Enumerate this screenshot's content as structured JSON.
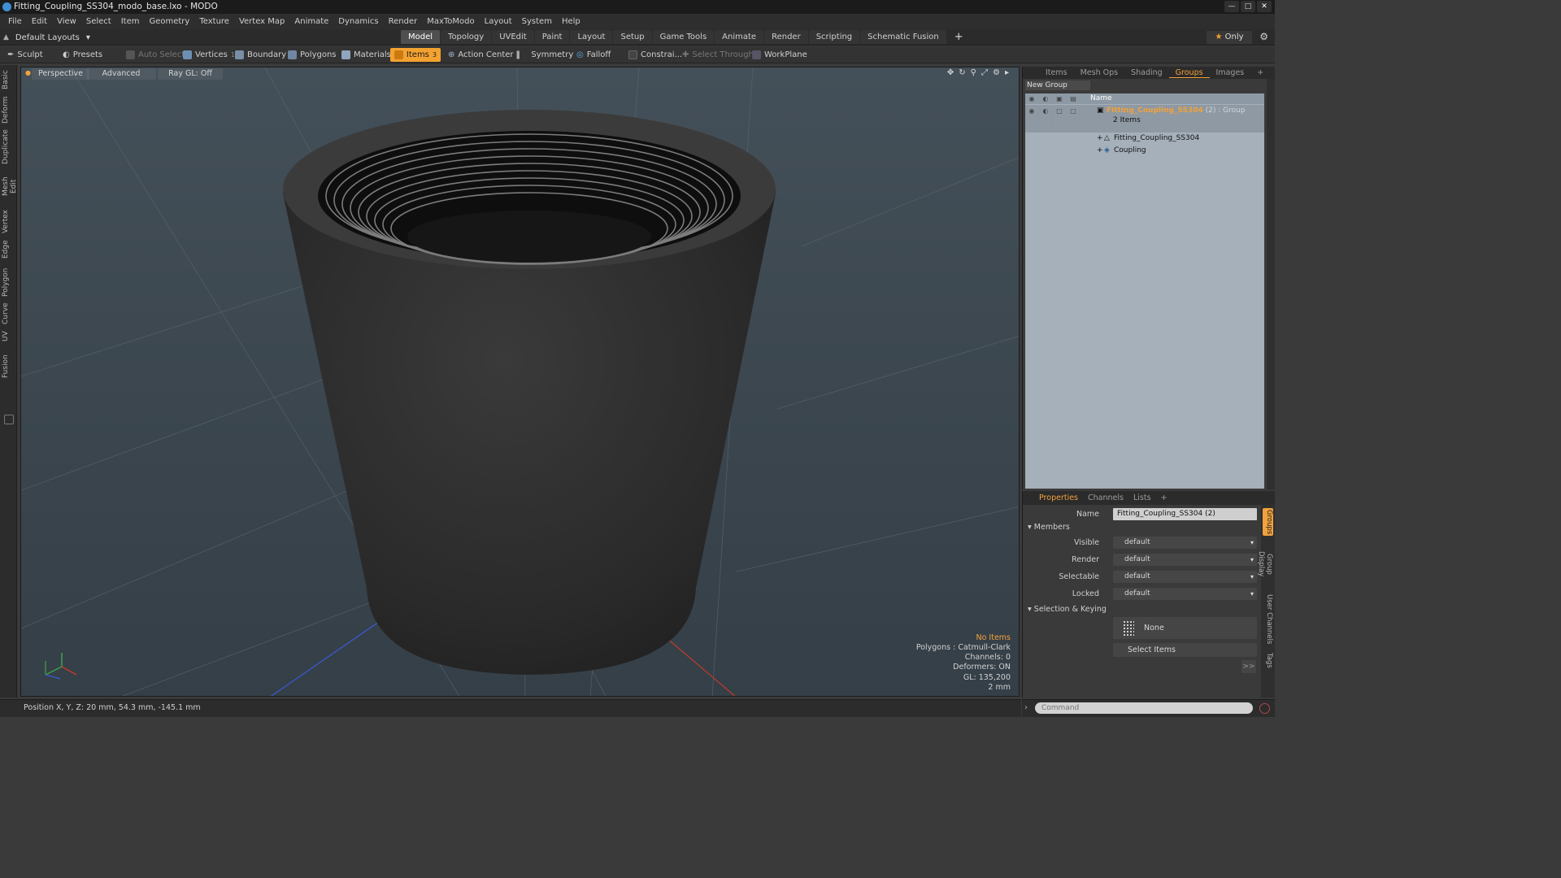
{
  "window": {
    "title": "Fitting_Coupling_SS304_modo_base.lxo - MODO"
  },
  "menu": [
    "File",
    "Edit",
    "View",
    "Select",
    "Item",
    "Geometry",
    "Texture",
    "Vertex Map",
    "Animate",
    "Dynamics",
    "Render",
    "MaxToModo",
    "Layout",
    "System",
    "Help"
  ],
  "layouts": {
    "label": "Default Layouts"
  },
  "mode_tabs": [
    "Model",
    "Topology",
    "UVEdit",
    "Paint",
    "Layout",
    "Setup",
    "Game Tools",
    "Animate",
    "Render",
    "Scripting",
    "Schematic Fusion"
  ],
  "active_mode": "Model",
  "only": {
    "label": "Only"
  },
  "toolbar": {
    "sculpt": "Sculpt",
    "presets": "Presets",
    "auto_select": "Auto Select",
    "vertices": "Vertices",
    "vertices_count": "1",
    "boundary": "Boundary",
    "polygons": "Polygons",
    "materials": "Materials",
    "items": "Items",
    "items_count": "3",
    "action_center": "Action Center",
    "symmetry": "Symmetry",
    "falloff": "Falloff",
    "constrain": "Constrai...",
    "select_through": "Select Through",
    "workplane": "WorkPlane"
  },
  "left_tabs": [
    "Basic",
    "Deform",
    "Duplicate",
    "Mesh Edit",
    "Vertex",
    "Edge",
    "Polygon",
    "Curve",
    "UV",
    "Fusion"
  ],
  "viewport": {
    "view": "Perspective",
    "shading": "Advanced",
    "raygl": "Ray GL: Off",
    "info": {
      "no_items": "No Items",
      "polygons": "Polygons : Catmull-Clark",
      "channels": "Channels: 0",
      "deformers": "Deformers: ON",
      "gl": "GL: 135,200",
      "unit": "2 mm"
    }
  },
  "status": {
    "position": "Position X, Y, Z:  20 mm, 54.3 mm, -145.1 mm"
  },
  "right_panel": {
    "tabs": [
      "Items",
      "Mesh Ops",
      "Shading",
      "Groups",
      "Images"
    ],
    "active_tab": "Groups",
    "new_group": "New Group",
    "column_name": "Name",
    "group": {
      "name": "Fitting_Coupling_SS304",
      "count": "(2)",
      "type": ": Group",
      "items_label": "2 Items"
    },
    "children": [
      "Fitting_Coupling_SS304",
      "Coupling"
    ]
  },
  "properties": {
    "tabs": [
      "Properties",
      "Channels",
      "Lists"
    ],
    "name_label": "Name",
    "name_value": "Fitting_Coupling_SS304 (2)",
    "members": "Members",
    "rows": [
      {
        "label": "Visible",
        "value": "default"
      },
      {
        "label": "Render",
        "value": "default"
      },
      {
        "label": "Selectable",
        "value": "default"
      },
      {
        "label": "Locked",
        "value": "default"
      }
    ],
    "selection_keying": "Selection & Keying",
    "none": "None",
    "select_items": "Select Items",
    "more": ">>",
    "side_tabs": [
      "Groups",
      "Group Display",
      "User Channels",
      "Tags"
    ]
  },
  "command": {
    "placeholder": "Command"
  },
  "colors": {
    "accent": "#f1a23c",
    "viewport_bg": "#3e4a52",
    "tree_bg": "#a5b0ba"
  }
}
